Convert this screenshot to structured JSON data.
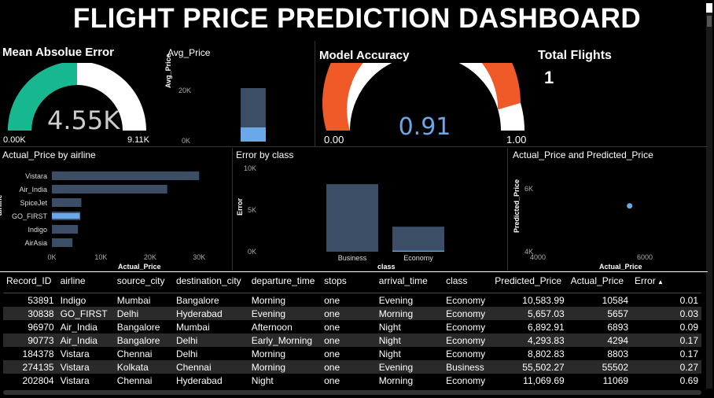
{
  "title": "FLIGHT PRICE PREDICTION DASHBOARD",
  "mae": {
    "title": "Mean Absolue Error",
    "value": "4.55K",
    "min": "0.00K",
    "max": "9.11K",
    "fraction": 0.5,
    "color": "#17b890"
  },
  "avg_price": {
    "title": "Avg_Price",
    "ylabel": "Avg_Price",
    "ticks": [
      "20K",
      "0K"
    ],
    "bar_color": "#3b4e66",
    "highlight_color": "#6aa9e9"
  },
  "accuracy": {
    "title": "Model Accuracy",
    "value": "0.91",
    "min": "0.00",
    "max": "1.00",
    "fraction": 0.91,
    "color": "#f05a28"
  },
  "total_flights": {
    "title": "Total Flights",
    "value": "1"
  },
  "chart_data": [
    {
      "type": "bar",
      "orientation": "horizontal",
      "title": "Actual_Price by airline",
      "xlabel": "Actual_Price",
      "ylabel": "airline",
      "categories": [
        "Vistara",
        "Air_India",
        "SpiceJet",
        "GO_FIRST",
        "Indigo",
        "AirAsia"
      ],
      "values": [
        30000,
        23500,
        6000,
        5800,
        5300,
        4200
      ],
      "highlight": [
        0,
        0,
        0,
        5657,
        0,
        0
      ],
      "x_ticks": [
        "0K",
        "10K",
        "20K",
        "30K"
      ],
      "xlim": [
        0,
        33000
      ]
    },
    {
      "type": "bar",
      "title": "Error by class",
      "xlabel": "class",
      "ylabel": "Error",
      "categories": [
        "Business",
        "Economy"
      ],
      "values": [
        8100,
        3000
      ],
      "highlight": [
        0,
        120
      ],
      "y_ticks": [
        "10K",
        "5K",
        "0K"
      ],
      "ylim": [
        0,
        10000
      ]
    },
    {
      "type": "scatter",
      "title": "Actual_Price and Predicted_Price",
      "xlabel": "Actual_Price",
      "ylabel": "Predicted_Price",
      "points": [
        {
          "x": 5657,
          "y": 5657
        }
      ],
      "x_ticks": [
        "4000",
        "6000"
      ],
      "y_ticks": [
        "6K",
        "4K"
      ],
      "xlim": [
        4000,
        6000
      ],
      "ylim": [
        4000,
        6300
      ]
    }
  ],
  "table": {
    "columns": [
      "Record_ID",
      "airline",
      "source_city",
      "destination_city",
      "departure_time",
      "stops",
      "arrival_time",
      "class",
      "Predicted_Price",
      "Actual_Price",
      "Error"
    ],
    "rows": [
      [
        "53891",
        "Indigo",
        "Mumbai",
        "Bangalore",
        "Morning",
        "one",
        "Evening",
        "Economy",
        "10,583.99",
        "10584",
        "0.01"
      ],
      [
        "30838",
        "GO_FIRST",
        "Delhi",
        "Hyderabad",
        "Evening",
        "one",
        "Morning",
        "Economy",
        "5,657.03",
        "5657",
        "0.03"
      ],
      [
        "96970",
        "Air_India",
        "Bangalore",
        "Mumbai",
        "Afternoon",
        "one",
        "Night",
        "Economy",
        "6,892.91",
        "6893",
        "0.09"
      ],
      [
        "90773",
        "Air_India",
        "Bangalore",
        "Delhi",
        "Early_Morning",
        "one",
        "Night",
        "Economy",
        "4,293.83",
        "4294",
        "0.17"
      ],
      [
        "184378",
        "Vistara",
        "Chennai",
        "Delhi",
        "Morning",
        "one",
        "Night",
        "Economy",
        "8,802.83",
        "8803",
        "0.17"
      ],
      [
        "274135",
        "Vistara",
        "Kolkata",
        "Chennai",
        "Morning",
        "one",
        "Evening",
        "Business",
        "55,502.27",
        "55502",
        "0.27"
      ],
      [
        "202804",
        "Vistara",
        "Chennai",
        "Hyderabad",
        "Night",
        "one",
        "Morning",
        "Economy",
        "11,069.69",
        "11069",
        "0.69"
      ]
    ]
  }
}
